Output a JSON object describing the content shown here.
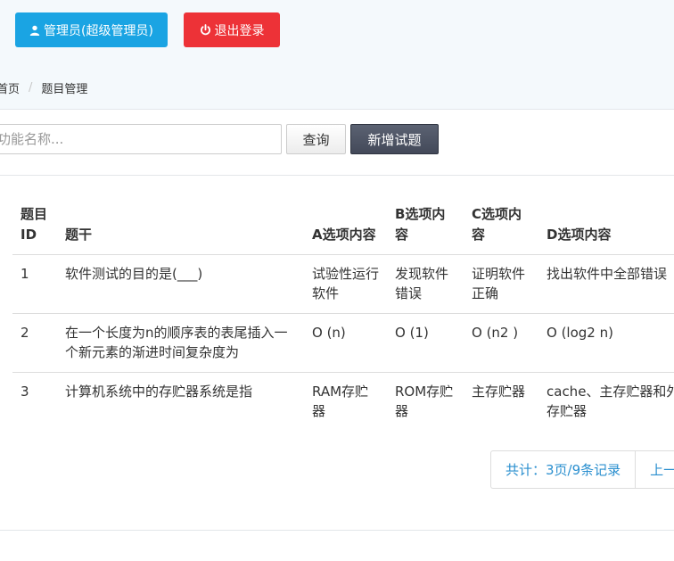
{
  "header": {
    "admin_label": "管理员(超级管理员)",
    "logout_label": "退出登录"
  },
  "breadcrumb": {
    "home": "首页",
    "current": "题目管理"
  },
  "search": {
    "placeholder": "功能名称...",
    "query_label": "查询",
    "add_label": "新增试题"
  },
  "table": {
    "headers": {
      "id": "题目ID",
      "stem": "题干",
      "a": "A选项内容",
      "b": "B选项内容",
      "c": "C选项内容",
      "d": "D选项内容"
    },
    "rows": [
      {
        "id": "1",
        "stem": "软件测试的目的是(___)",
        "a": "试验性运行软件",
        "b": "发现软件错误",
        "c": "证明软件正确",
        "d": "找出软件中全部错误"
      },
      {
        "id": "2",
        "stem": "在一个长度为n的顺序表的表尾插入一个新元素的渐进时间复杂度为",
        "a": "O (n)",
        "b": "O (1)",
        "c": "O (n2 )",
        "d": "O (log2 n)"
      },
      {
        "id": "3",
        "stem": "计算机系统中的存贮器系统是指",
        "a": "RAM存贮器",
        "b": "ROM存贮器",
        "c": "主存贮器",
        "d": "cache、主存贮器和外存贮器"
      }
    ]
  },
  "pagination": {
    "total": "共计：3页/9条记录",
    "prev": "上一页"
  }
}
